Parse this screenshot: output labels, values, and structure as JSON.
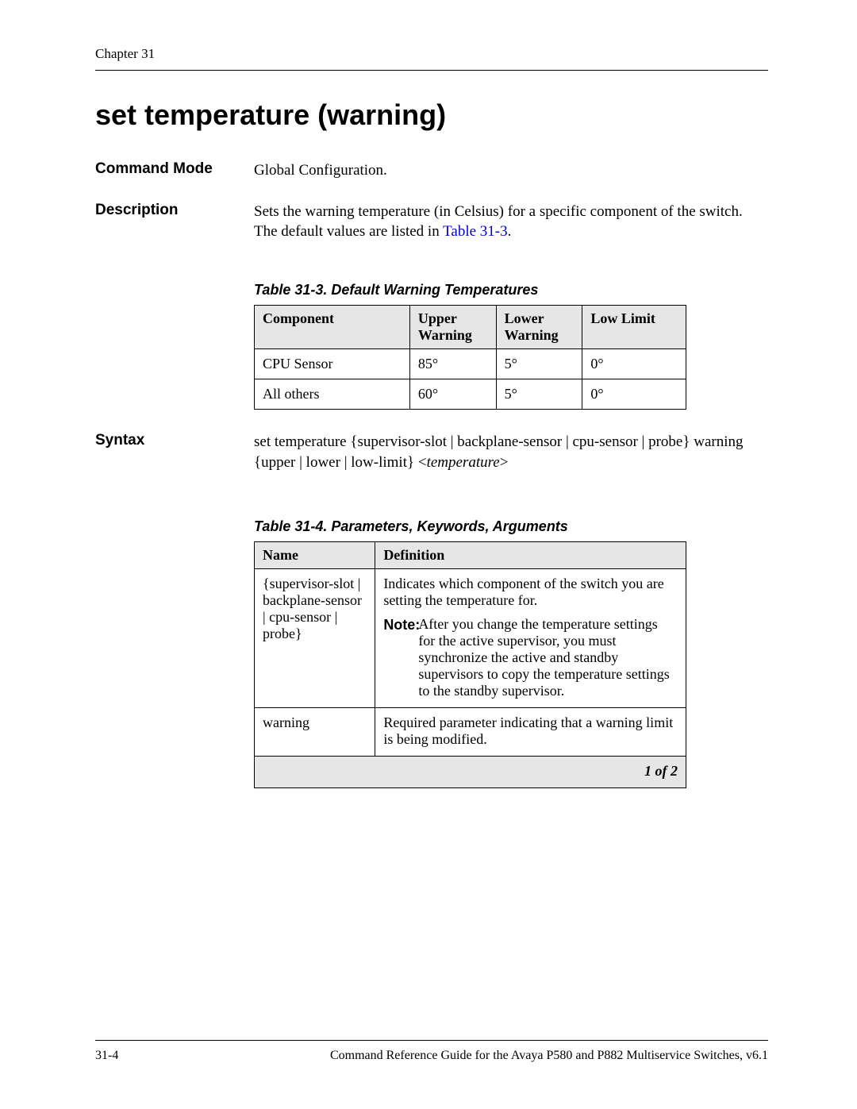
{
  "chapter": "Chapter 31",
  "title": "set temperature (warning)",
  "fields": {
    "command_mode": {
      "label": "Command Mode",
      "value": "Global Configuration."
    },
    "description": {
      "label": "Description",
      "text_before": "Sets the warning temperature (in Celsius) for a specific component of the switch. The default values are listed in ",
      "link": "Table 31-3",
      "text_after": "."
    },
    "syntax": {
      "label": "Syntax",
      "line1": "set temperature {supervisor-slot | backplane-sensor | cpu-sensor | probe} warning {upper | lower | low-limit} <",
      "arg": "temperature",
      "line1_end": ">"
    }
  },
  "table3": {
    "caption": "Table 31-3.  Default Warning Temperatures",
    "headers": [
      "Component",
      "Upper Warning",
      "Lower Warning",
      "Low Limit"
    ],
    "rows": [
      [
        "CPU Sensor",
        "85°",
        "5°",
        "0°"
      ],
      [
        "All others",
        "60°",
        "5°",
        "0°"
      ]
    ]
  },
  "table4": {
    "caption": "Table 31-4.  Parameters, Keywords, Arguments",
    "headers": [
      "Name",
      "Definition"
    ],
    "row1_name": "{supervisor-slot | backplane-sensor | cpu-sensor | probe}",
    "row1_def_top": "Indicates which component of the switch you are setting the temperature for.",
    "row1_note_label": "Note:",
    "row1_note_body": "After you change the temperature settings for the active supervisor, you must synchronize the active and standby supervisors to copy the temperature settings to the standby supervisor.",
    "row2_name": "warning",
    "row2_def": "Required parameter indicating that a warning limit is being modified.",
    "pager": "1 of 2"
  },
  "footer": {
    "page": "31-4",
    "doc": "Command Reference Guide for the Avaya P580 and P882 Multiservice Switches, v6.1"
  }
}
